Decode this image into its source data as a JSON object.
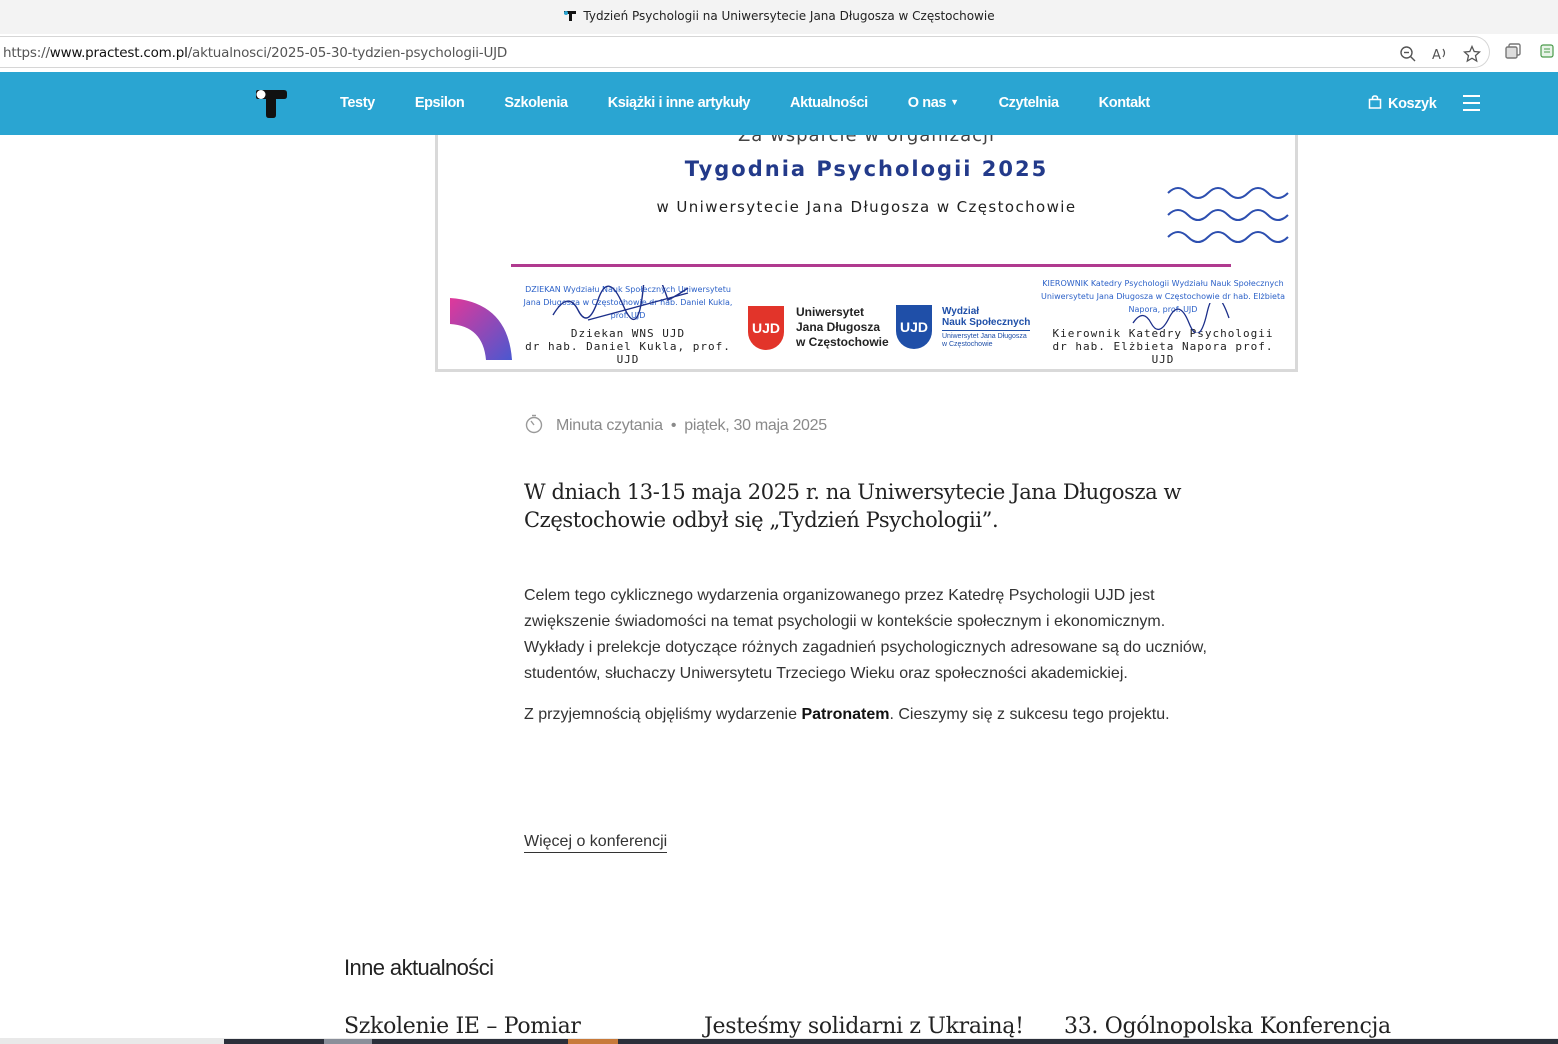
{
  "browser": {
    "tab_title": "Tydzień Psychologii na Uniwersytecie Jana Długosza w Częstochowie",
    "url_prefix": "https://",
    "url_domain": "www.practest.com.pl",
    "url_path": "/aktualnosci/2025-05-30-tydzien-psychologii-UJD",
    "icons": [
      "zoom-out-icon",
      "read-aloud-icon",
      "favorite-star-icon",
      "collections-icon",
      "extension-icon"
    ]
  },
  "nav": {
    "items": [
      "Testy",
      "Epsilon",
      "Szkolenia",
      "Książki i inne artykuły",
      "Aktualności",
      "O nas",
      "Czytelnia",
      "Kontakt"
    ],
    "cart_label": "Koszyk",
    "background": "#2aa5d2"
  },
  "poster": {
    "cut_line": "Za wsparcie w organizacji",
    "headline": "Tygodnia Psychologii 2025",
    "subline": "w Uniwersytecie Jana Długosza w Częstochowie",
    "left_signature_stamp": "DZIEKAN Wydziału Nauk Społecznych Uniwersytetu Jana Długosza w Częstochowie dr hab. Daniel Kukla, prof. UJD",
    "left_signature_title": "Dziekan WNS UJD",
    "left_signature_name": "dr hab. Daniel Kukla, prof. UJD",
    "ujd_badge": "UJD",
    "ujd_name_1": "Uniwersytet",
    "ujd_name_2": "Jana Długosza",
    "ujd_name_3": "w Częstochowie",
    "wns_badge": "UJD",
    "wns_name_1": "Wydział",
    "wns_name_2": "Nauk Społecznych",
    "wns_small_1": "Uniwersytet Jana Długosza",
    "wns_small_2": "w Częstochowie",
    "right_signature_stamp": "KIEROWNIK Katedry Psychologii Wydziału Nauk Społecznych Uniwersytetu Jana Długosza w Częstochowie dr hab. Elżbieta Napora, prof. UJD",
    "right_signature_title": "Kierownik Katedry Psychologii",
    "right_signature_name": "dr hab. Elżbieta Napora prof. UJD"
  },
  "article": {
    "reading_time": "Minuta czytania",
    "separator": "•",
    "date": "piątek, 30 maja 2025",
    "lead": "W dniach 13-15 maja 2025 r. na Uniwersytecie Jana Długosza w Częstochowie odbył się „Tydzień Psychologii”.",
    "paragraph_1": "Celem tego cyklicznego wydarzenia organizowanego przez Katedrę Psychologii UJD jest zwiększenie świadomości na temat psychologii w kontekście społecznym i ekonomicznym. Wykłady i prelekcje dotyczące różnych zagadnień psychologicznych adresowane są do uczniów, studentów, słuchaczy Uniwersytetu Trzeciego Wieku oraz społeczności akademickiej.",
    "paragraph_2_before": "Z przyjemnością objęliśmy wydarzenie ",
    "paragraph_2_bold": "Patronatem",
    "paragraph_2_after": ". Cieszymy się z sukcesu tego projektu.",
    "more_link": "Więcej o konferencji"
  },
  "other_news": {
    "heading": "Inne aktualności",
    "cards": [
      "Szkolenie IE – Pomiar",
      "Jesteśmy solidarni z Ukrainą!",
      "33. Ogólnopolska Konferencja"
    ]
  }
}
